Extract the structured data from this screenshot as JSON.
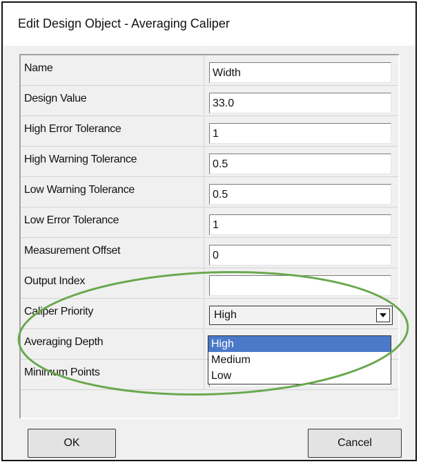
{
  "window": {
    "title": "Edit Design Object - Averaging Caliper"
  },
  "rows": [
    {
      "label": "Name",
      "value": "Width"
    },
    {
      "label": "Design Value",
      "value": "33.0"
    },
    {
      "label": "High Error Tolerance",
      "value": "1"
    },
    {
      "label": "High Warning Tolerance",
      "value": "0.5"
    },
    {
      "label": "Low Warning Tolerance",
      "value": "0.5"
    },
    {
      "label": "Low Error Tolerance",
      "value": "1"
    },
    {
      "label": "Measurement Offset",
      "value": "0"
    },
    {
      "label": "Output Index",
      "value": ""
    },
    {
      "label": "Caliper Priority",
      "value": "High"
    },
    {
      "label": "Averaging Depth",
      "value": ""
    },
    {
      "label": "Minimum Points",
      "value": ""
    }
  ],
  "dropdown": {
    "options": [
      "High",
      "Medium",
      "Low"
    ],
    "selected": "High"
  },
  "buttons": {
    "ok": "OK",
    "cancel": "Cancel"
  },
  "colors": {
    "highlight": "#4a79c8",
    "annotation": "#6aa84f"
  }
}
